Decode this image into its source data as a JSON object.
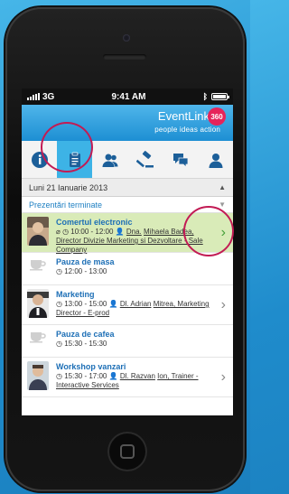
{
  "status": {
    "carrier": "3G",
    "time": "9:41 AM"
  },
  "header": {
    "brand": "EventLink",
    "badge": "360",
    "tagline": "people ideas action"
  },
  "tabs": [
    {
      "name": "info",
      "icon": "info-icon"
    },
    {
      "name": "agenda",
      "icon": "clipboard-icon"
    },
    {
      "name": "people",
      "icon": "people-icon"
    },
    {
      "name": "vote",
      "icon": "gavel-icon"
    },
    {
      "name": "chat",
      "icon": "chat-icon"
    },
    {
      "name": "profile",
      "icon": "user-icon"
    }
  ],
  "day": {
    "label": "Luni 21 Ianuarie 2013"
  },
  "section": {
    "label": "Prezentări terminate"
  },
  "items": [
    {
      "title": "Comertul electronic",
      "time": "10:00 - 12:00",
      "speaker_prefix": "Dna.",
      "speaker": "Mihaela Badea, Director Divizie Marketing si Dezvoltare - Sale Company"
    },
    {
      "title": "Pauza de masa",
      "time": "12:00 - 13:00"
    },
    {
      "title": "Marketing",
      "time": "13:00 - 15:00",
      "speaker_prefix": "Dl. Adrian",
      "speaker": "Mitrea, Marketing Director - E-prod"
    },
    {
      "title": "Pauza de cafea",
      "time": "15:30 - 15:30"
    },
    {
      "title": "Workshop vanzari",
      "time": "15:30 - 17:00",
      "speaker_prefix": "Dl. Razvan",
      "speaker": "Ion, Trainer - Interactive Services"
    }
  ],
  "colors": {
    "accent": "#3db3e6",
    "highlight": "#d9ebb8",
    "annotation": "#c21b54"
  }
}
